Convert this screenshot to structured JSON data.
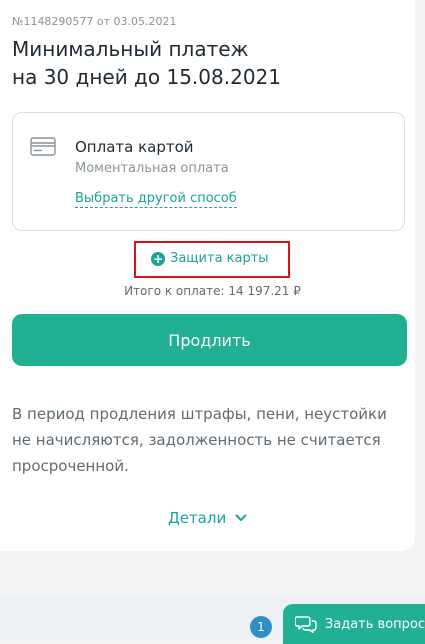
{
  "header": {
    "contract_number": "№1148290577 от 03.05.2021",
    "title_line1": "Минимальный платеж",
    "title_line2": "на 30 дней до 15.08.2021"
  },
  "payment_method": {
    "icon": "credit-card-icon",
    "title": "Оплата картой",
    "subtitle": "Моментальная оплата",
    "change_link": "Выбрать другой способ"
  },
  "card_protection": {
    "icon": "plus-circle-icon",
    "label": "Защита карты",
    "highlight_color": "#d9121b"
  },
  "total_text": "Итого к оплате: 14 197.21 ₽",
  "extend_button": "Продлить",
  "info_text": "В период продления штрафы, пени, неустойки не начисляются, задолженность не считается просроченной.",
  "details_link": "Детали",
  "chat": {
    "badge_count": "1",
    "button_label": "Задать вопрос",
    "icon": "chat-icon"
  },
  "colors": {
    "accent": "#21b091",
    "link": "#1ba39a",
    "badge": "#2f8fc4"
  }
}
